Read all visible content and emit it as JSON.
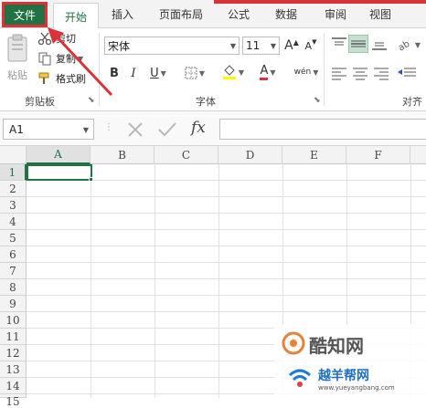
{
  "tabs": {
    "file": "文件",
    "home": "开始",
    "insert": "插入",
    "page_layout": "页面布局",
    "formulas": "公式",
    "data": "数据",
    "review": "审阅",
    "view": "视图"
  },
  "clipboard": {
    "paste": "粘贴",
    "cut": "剪切",
    "copy": "复制",
    "format_painter": "格式刷",
    "group_label": "剪贴板"
  },
  "font": {
    "name": "宋体",
    "size": "11",
    "bold": "B",
    "italic": "I",
    "underline": "U",
    "grow": "A",
    "shrink": "A",
    "wen": "wén",
    "color_a": "A",
    "group_label": "字体"
  },
  "alignment": {
    "group_label": "对齐方"
  },
  "formula_bar": {
    "name_box": "A1",
    "fx": "fx"
  },
  "columns": [
    "A",
    "B",
    "C",
    "D",
    "E",
    "F"
  ],
  "rows": [
    "1",
    "2",
    "3",
    "4",
    "5",
    "6",
    "7",
    "8",
    "9",
    "10",
    "11",
    "12",
    "13",
    "14",
    "15"
  ],
  "watermark": {
    "line1": "酷知网",
    "line2": "越羊帮网",
    "url": "www.yueyangbang.com"
  },
  "colors": {
    "excel_green": "#217346",
    "highlight_red": "#d9333a"
  }
}
